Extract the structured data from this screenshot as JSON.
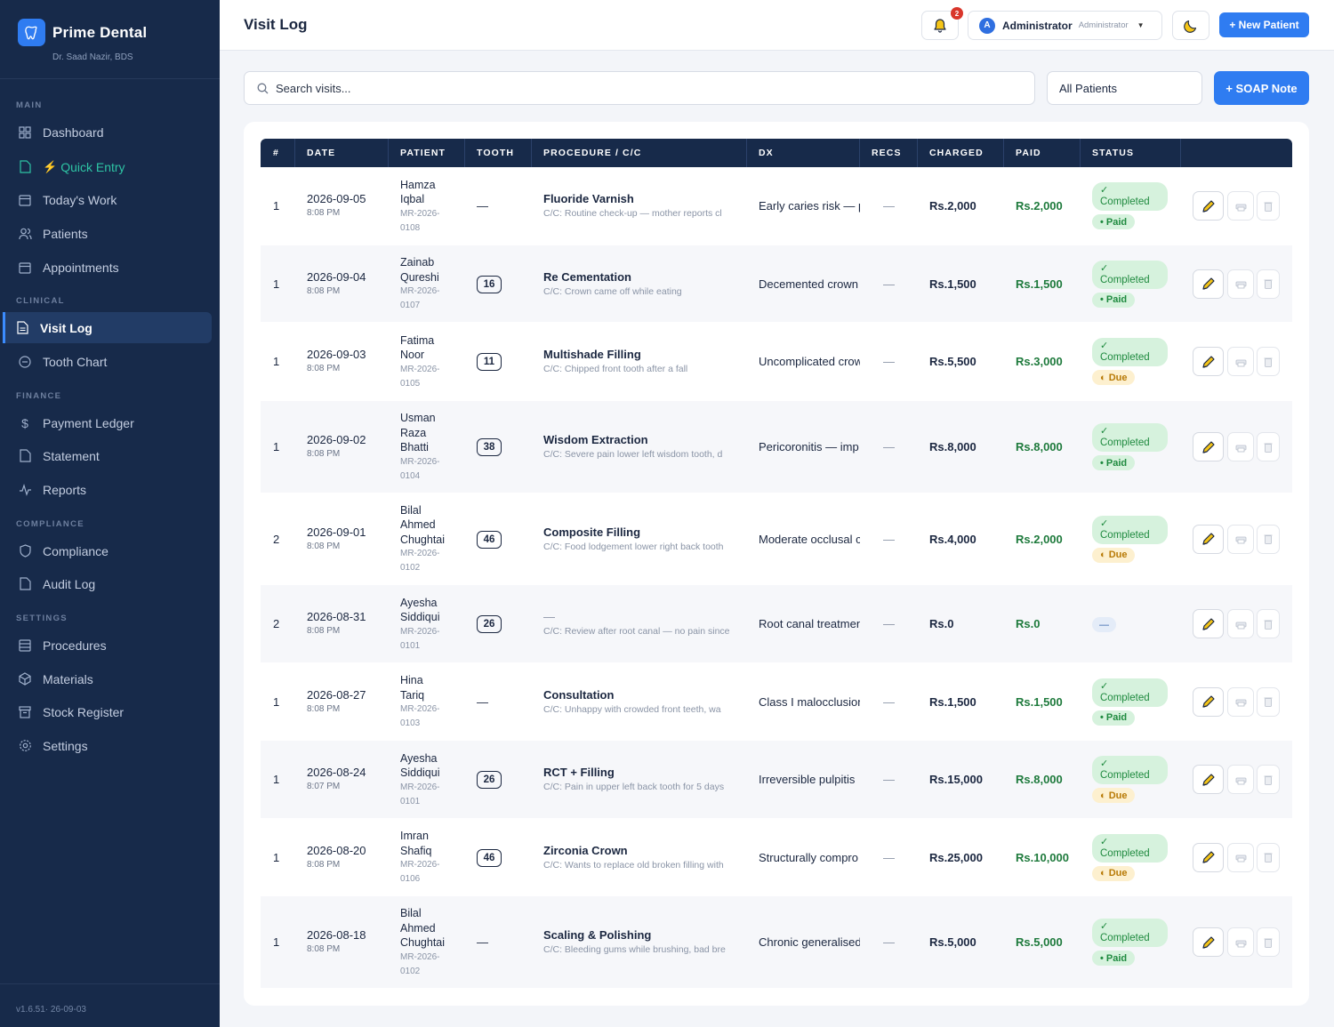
{
  "brand": {
    "name": "Prime Dental",
    "doctor": "Dr. Saad Nazir, BDS"
  },
  "sidebar": {
    "sections": {
      "main": "MAIN",
      "clinical": "CLINICAL",
      "finance": "FINANCE",
      "compliance": "COMPLIANCE",
      "settings": "SETTINGS"
    },
    "items": {
      "dashboard": "Dashboard",
      "quick_entry": "Quick Entry",
      "todays_work": "Today's Work",
      "patients": "Patients",
      "appointments": "Appointments",
      "visit_log": "Visit Log",
      "tooth_chart": "Tooth Chart",
      "payment_ledger": "Payment Ledger",
      "statement": "Statement",
      "reports": "Reports",
      "compliance": "Compliance",
      "audit_log": "Audit Log",
      "procedures": "Procedures",
      "materials": "Materials",
      "stock_register": "Stock Register",
      "settings": "Settings"
    },
    "version": "v1.6.51· 26-09-03"
  },
  "header": {
    "title": "Visit Log",
    "notification_count": "2",
    "user": {
      "avatar_letter": "A",
      "name": "Administrator",
      "role": "Administrator"
    },
    "new_patient_label": "+ New Patient"
  },
  "filters": {
    "search_placeholder": "Search visits...",
    "patient_filter": "All Patients",
    "soap_label": "+ SOAP Note"
  },
  "table": {
    "columns": [
      "#",
      "DATE",
      "PATIENT",
      "TOOTH",
      "PROCEDURE / C/C",
      "DX",
      "RECS",
      "CHARGED",
      "PAID",
      "STATUS"
    ],
    "status_completed": "Completed",
    "rows": [
      {
        "num": "1",
        "date": "2026-09-05",
        "time": "8:08 PM",
        "patient": [
          "Hamza",
          "Iqbal"
        ],
        "mr": [
          "MR-2026-",
          "0108"
        ],
        "tooth": "—",
        "procedure": "Fluoride Varnish",
        "cc": "C/C: Routine check-up — mother reports cl",
        "dx": "Early caries risk — p",
        "recs": "—",
        "charged": "Rs.2,000",
        "paid": "Rs.2,000",
        "completed": true,
        "payment": "• Paid",
        "payment_type": "paid"
      },
      {
        "num": "1",
        "date": "2026-09-04",
        "time": "8:08 PM",
        "patient": [
          "Zainab",
          "Qureshi"
        ],
        "mr": [
          "MR-2026-",
          "0107"
        ],
        "tooth": "16",
        "procedure": "Re Cementation",
        "cc": "C/C: Crown came off while eating",
        "dx": "Decemented crown",
        "recs": "—",
        "charged": "Rs.1,500",
        "paid": "Rs.1,500",
        "completed": true,
        "payment": "• Paid",
        "payment_type": "paid"
      },
      {
        "num": "1",
        "date": "2026-09-03",
        "time": "8:08 PM",
        "patient": [
          "Fatima",
          "Noor"
        ],
        "mr": [
          "MR-2026-",
          "0105"
        ],
        "tooth": "11",
        "procedure": "Multishade Filling",
        "cc": "C/C: Chipped front tooth after a fall",
        "dx": "Uncomplicated crown",
        "recs": "—",
        "charged": "Rs.5,500",
        "paid": "Rs.3,000",
        "completed": true,
        "payment": "◐ Due",
        "payment_type": "due"
      },
      {
        "num": "1",
        "date": "2026-09-02",
        "time": "8:08 PM",
        "patient": [
          "Usman",
          "Raza",
          "Bhatti"
        ],
        "mr": [
          "MR-2026-",
          "0104"
        ],
        "tooth": "38",
        "procedure": "Wisdom Extraction",
        "cc": "C/C: Severe pain lower left wisdom tooth, d",
        "dx": "Pericoronitis — imp",
        "recs": "—",
        "charged": "Rs.8,000",
        "paid": "Rs.8,000",
        "completed": true,
        "payment": "• Paid",
        "payment_type": "paid"
      },
      {
        "num": "2",
        "date": "2026-09-01",
        "time": "8:08 PM",
        "patient": [
          "Bilal",
          "Ahmed",
          "Chughtai"
        ],
        "mr": [
          "MR-2026-",
          "0102"
        ],
        "tooth": "46",
        "procedure": "Composite Filling",
        "cc": "C/C: Food lodgement lower right back tooth",
        "dx": "Moderate occlusal c",
        "recs": "—",
        "charged": "Rs.4,000",
        "paid": "Rs.2,000",
        "completed": true,
        "payment": "◐ Due",
        "payment_type": "due"
      },
      {
        "num": "2",
        "date": "2026-08-31",
        "time": "8:08 PM",
        "patient": [
          "Ayesha",
          "Siddiqui"
        ],
        "mr": [
          "MR-2026-",
          "0101"
        ],
        "tooth": "26",
        "procedure": "—",
        "cc": "C/C: Review after root canal — no pain since",
        "dx": "Root canal treatment",
        "recs": "—",
        "charged": "Rs.0",
        "paid": "Rs.0",
        "completed": false,
        "payment": "—",
        "payment_type": "none"
      },
      {
        "num": "1",
        "date": "2026-08-27",
        "time": "8:08 PM",
        "patient": [
          "Hina",
          "Tariq"
        ],
        "mr": [
          "MR-2026-",
          "0103"
        ],
        "tooth": "—",
        "procedure": "Consultation",
        "cc": "C/C: Unhappy with crowded front teeth, wa",
        "dx": "Class I malocclusion",
        "recs": "—",
        "charged": "Rs.1,500",
        "paid": "Rs.1,500",
        "completed": true,
        "payment": "• Paid",
        "payment_type": "paid"
      },
      {
        "num": "1",
        "date": "2026-08-24",
        "time": "8:07 PM",
        "patient": [
          "Ayesha",
          "Siddiqui"
        ],
        "mr": [
          "MR-2026-",
          "0101"
        ],
        "tooth": "26",
        "procedure": "RCT + Filling",
        "cc": "C/C: Pain in upper left back tooth for 5 days",
        "dx": "Irreversible pulpitis",
        "recs": "—",
        "charged": "Rs.15,000",
        "paid": "Rs.8,000",
        "completed": true,
        "payment": "◐ Due",
        "payment_type": "due"
      },
      {
        "num": "1",
        "date": "2026-08-20",
        "time": "8:08 PM",
        "patient": [
          "Imran",
          "Shafiq"
        ],
        "mr": [
          "MR-2026-",
          "0106"
        ],
        "tooth": "46",
        "procedure": "Zirconia Crown",
        "cc": "C/C: Wants to replace old broken filling with",
        "dx": "Structurally compro",
        "recs": "—",
        "charged": "Rs.25,000",
        "paid": "Rs.10,000",
        "completed": true,
        "payment": "◐ Due",
        "payment_type": "due"
      },
      {
        "num": "1",
        "date": "2026-08-18",
        "time": "8:08 PM",
        "patient": [
          "Bilal",
          "Ahmed",
          "Chughtai"
        ],
        "mr": [
          "MR-2026-",
          "0102"
        ],
        "tooth": "—",
        "procedure": "Scaling & Polishing",
        "cc": "C/C: Bleeding gums while brushing, bad bre",
        "dx": "Chronic generalised",
        "recs": "—",
        "charged": "Rs.5,000",
        "paid": "Rs.5,000",
        "completed": true,
        "payment": "• Paid",
        "payment_type": "paid"
      }
    ]
  }
}
